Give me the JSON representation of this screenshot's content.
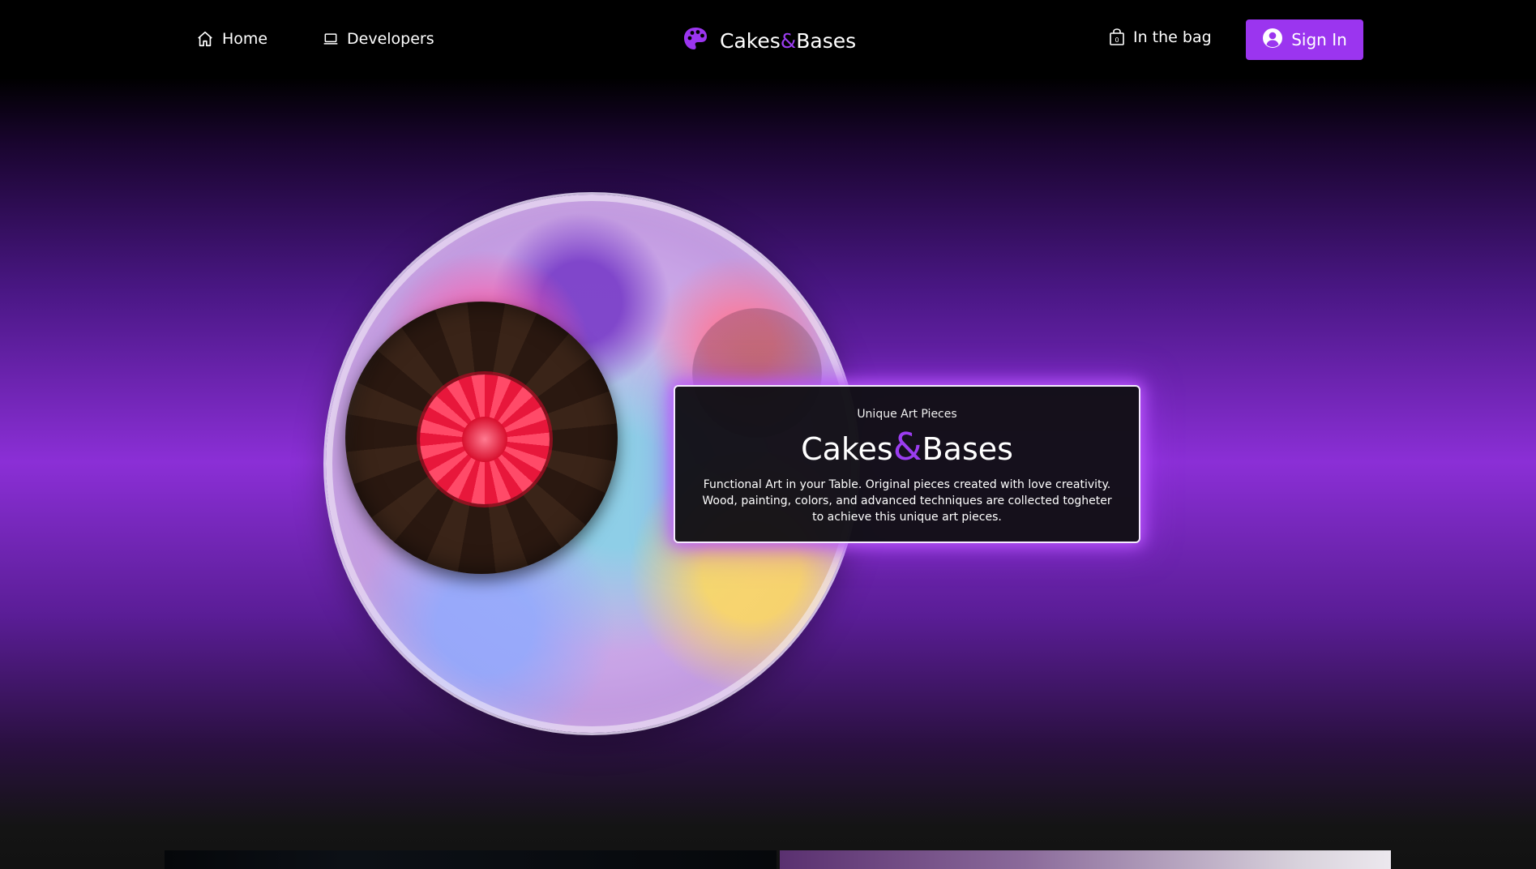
{
  "nav": {
    "home_label": "Home",
    "developers_label": "Developers",
    "brand_part1": "Cakes",
    "brand_amp": "&",
    "brand_part2": "Bases",
    "bag_label": "In the bag",
    "signin_label": "Sign In"
  },
  "hero": {
    "eyebrow": "Unique Art Pieces",
    "title_part1": "Cakes",
    "title_amp": "&",
    "title_part2": "Bases",
    "description": "Functional Art in your Table. Original pieces created with love creativity. Wood, painting, colors, and advanced techniques are collected togheter to achieve this unique art pieces."
  },
  "colors": {
    "accent": "#9b35ef",
    "nav_background": "#000000",
    "glow": "#b45aff"
  },
  "icons": {
    "home": "home-icon",
    "developers": "laptop-icon",
    "brand": "palette-icon",
    "bag": "shopping-bag-icon",
    "signin": "user-circle-icon"
  }
}
